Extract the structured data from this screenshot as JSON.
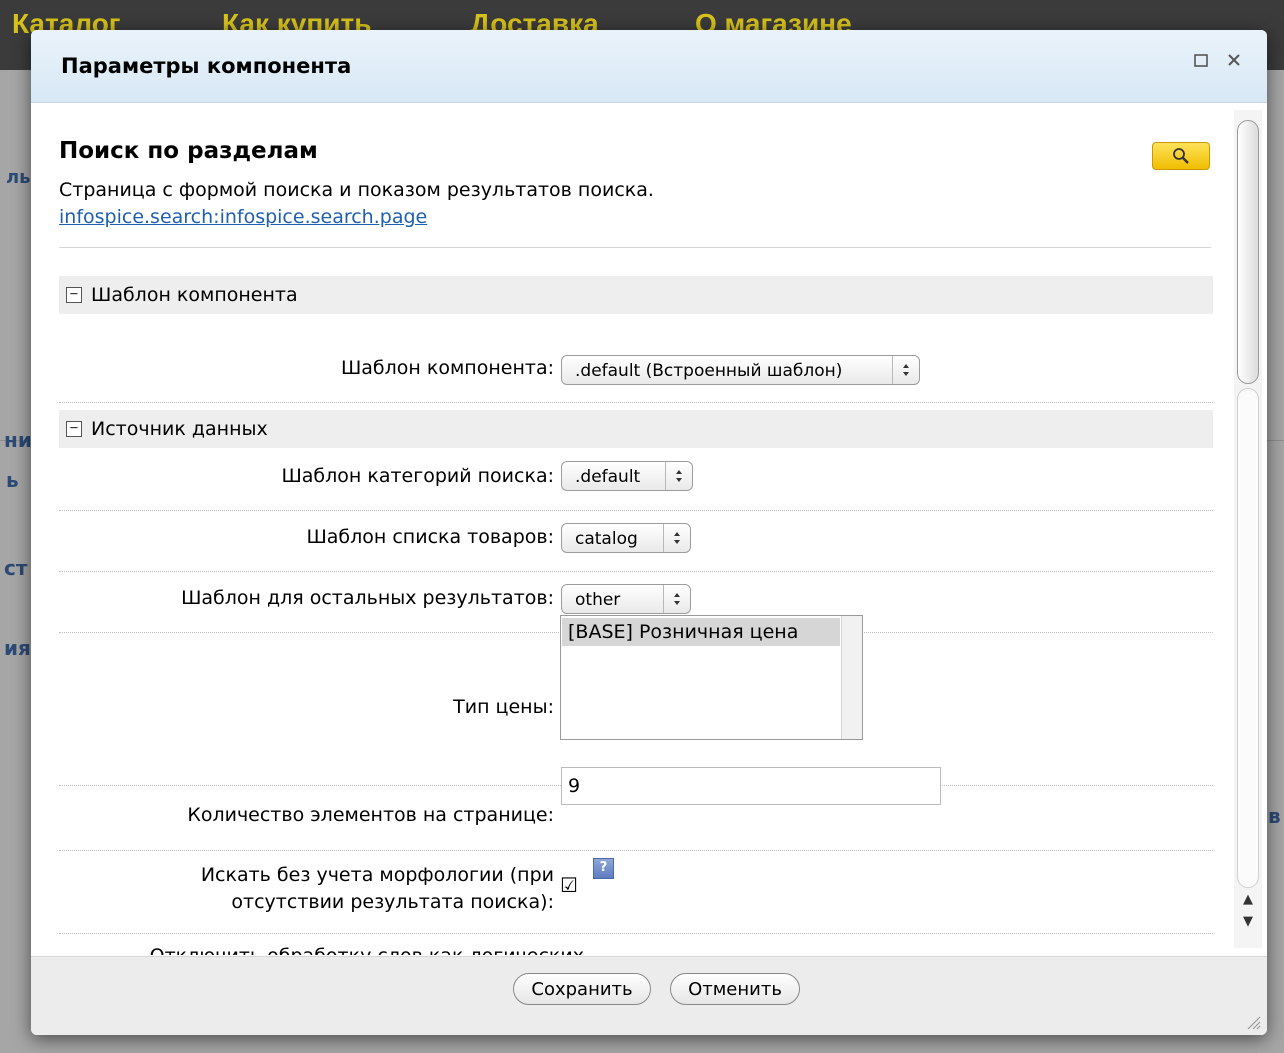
{
  "background": {
    "nav_items": [
      "Каталог",
      "Как купить",
      "Доставка",
      "О магазине"
    ],
    "fragments": [
      "ль",
      "ни",
      "ь",
      "ст",
      "ия",
      "в"
    ]
  },
  "dialog": {
    "title": "Параметры компонента",
    "maximize_icon": "maximize-icon",
    "close_icon": "close-icon",
    "component": {
      "name": "Поиск по разделам",
      "description": "Страница с формой поиска и показом результатов поиска.",
      "link": "infospice.search:infospice.search.page"
    },
    "groups": [
      {
        "toggle": "−",
        "label": "Шаблон компонента"
      },
      {
        "toggle": "−",
        "label": "Источник данных"
      }
    ],
    "fields": {
      "component_template": {
        "label": "Шаблон компонента:",
        "value": ".default (Встроенный шаблон)"
      },
      "search_category_template": {
        "label": "Шаблон категорий поиска:",
        "value": ".default"
      },
      "product_list_template": {
        "label": "Шаблон списка товаров:",
        "value": "catalog"
      },
      "other_results_template": {
        "label": "Шаблон для остальных результатов:",
        "value": "other"
      },
      "price_type": {
        "label": "Тип цены:",
        "options": [
          "[BASE] Розничная цена"
        ]
      },
      "items_per_page": {
        "label": "Количество элементов на странице:",
        "value": "9"
      },
      "search_without_morphology": {
        "label": "Искать без учета морфологии (при отсутствии результата поиска):",
        "checked": true,
        "help": "?"
      },
      "disable_logical_words": {
        "label": "Отключить обработку слов как логических",
        "checked": true
      }
    },
    "buttons": {
      "save": "Сохранить",
      "cancel": "Отменить"
    }
  }
}
